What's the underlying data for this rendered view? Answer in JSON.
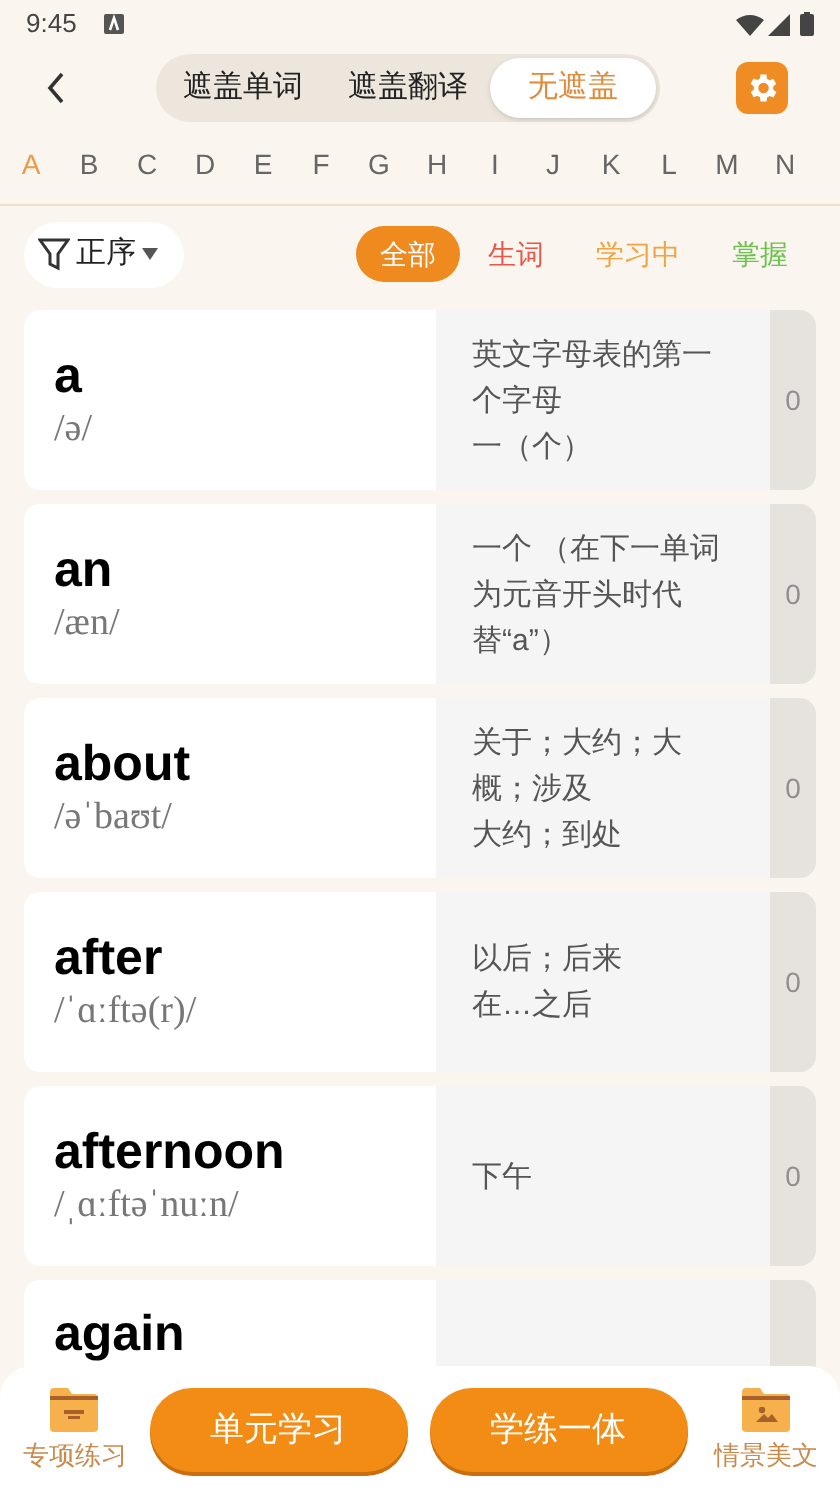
{
  "status_bar": {
    "time": "9:45"
  },
  "cover_tabs": [
    {
      "label": "遮盖单词",
      "selected": false
    },
    {
      "label": "遮盖翻译",
      "selected": false
    },
    {
      "label": "无遮盖",
      "selected": true
    }
  ],
  "letters": [
    {
      "label": "A",
      "selected": true
    },
    {
      "label": "B",
      "selected": false
    },
    {
      "label": "C",
      "selected": false
    },
    {
      "label": "D",
      "selected": false
    },
    {
      "label": "E",
      "selected": false
    },
    {
      "label": "F",
      "selected": false
    },
    {
      "label": "G",
      "selected": false
    },
    {
      "label": "H",
      "selected": false
    },
    {
      "label": "I",
      "selected": false
    },
    {
      "label": "J",
      "selected": false
    },
    {
      "label": "K",
      "selected": false
    },
    {
      "label": "L",
      "selected": false
    },
    {
      "label": "M",
      "selected": false
    },
    {
      "label": "N",
      "selected": false
    }
  ],
  "sort": {
    "label": "正序"
  },
  "filters": [
    {
      "label": "全部",
      "selected": true,
      "color": "#ee8a1e"
    },
    {
      "label": "生词",
      "selected": false,
      "color": "#e55a4a"
    },
    {
      "label": "学习中",
      "selected": false,
      "color": "#f0a443"
    },
    {
      "label": "掌握",
      "selected": false,
      "color": "#6dc24f"
    }
  ],
  "words": [
    {
      "word": "a",
      "phonetic": "/ə/",
      "translation": [
        "英文字母表的第一个字母",
        "一（个）"
      ],
      "count": "0"
    },
    {
      "word": "an",
      "phonetic": "/æn/",
      "translation": [
        "一个 （在下一单词为元音开头时代替“a”）"
      ],
      "count": "0"
    },
    {
      "word": "about",
      "phonetic": "/əˈbaʊt/",
      "translation": [
        "关于；大约；大概；涉及",
        "大约；到处"
      ],
      "count": "0"
    },
    {
      "word": "after",
      "phonetic": "/ˈɑːftə(r)/",
      "translation": [
        "以后；后来",
        "在…之后"
      ],
      "count": "0"
    },
    {
      "word": "afternoon",
      "phonetic": "/ˌɑːftəˈnuːn/",
      "translation": [
        "下午"
      ],
      "count": "0"
    },
    {
      "word": "again"
    }
  ],
  "bottom_bar": {
    "left": "专项练习",
    "buttons": [
      "单元学习",
      "学练一体"
    ],
    "right": "情景美文"
  }
}
